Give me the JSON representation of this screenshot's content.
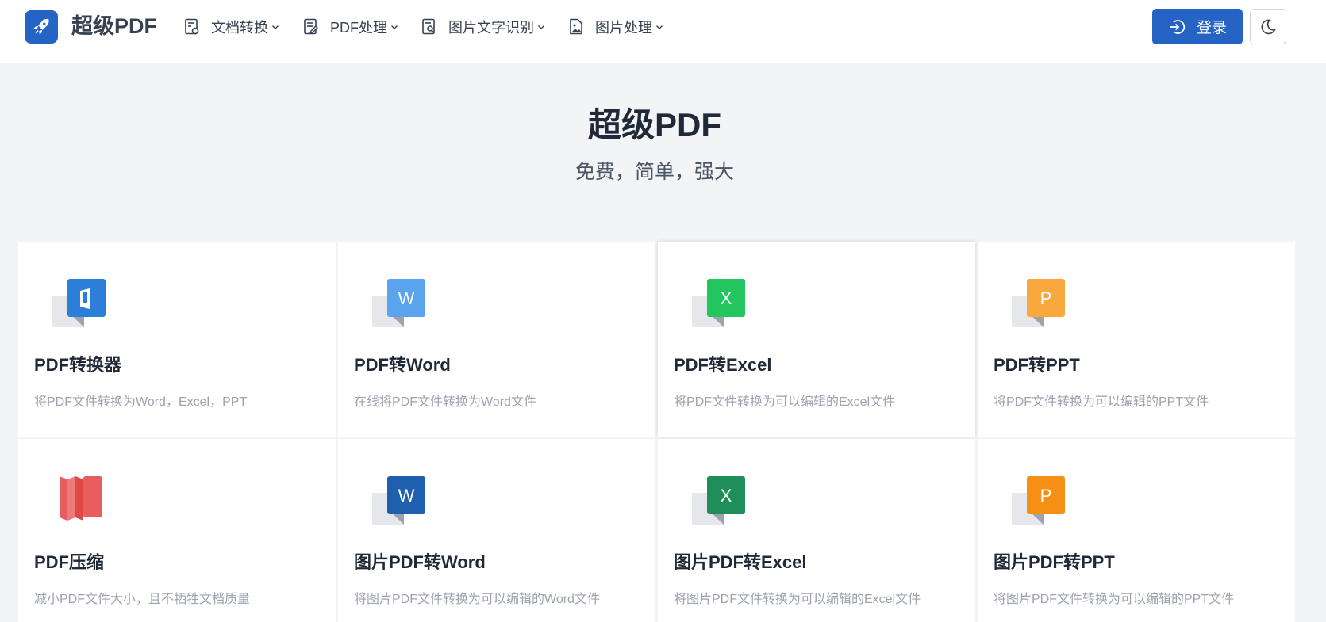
{
  "brand": {
    "name": "超级PDF"
  },
  "nav": {
    "items": [
      {
        "label": "文档转换"
      },
      {
        "label": "PDF处理"
      },
      {
        "label": "图片文字识别"
      },
      {
        "label": "图片处理"
      }
    ],
    "login_label": "登录"
  },
  "hero": {
    "title": "超级PDF",
    "subtitle": "免费，简单，强大"
  },
  "colors": {
    "primary": "#2563c4",
    "converter": "#2b7fd9",
    "word_light": "#5aa4ee",
    "excel_light": "#22c55e",
    "ppt_light": "#f8a83c",
    "compress": "#e85d5d",
    "word_dark": "#1e5fae",
    "excel_dark": "#1f8f5a",
    "ppt_dark": "#f59015"
  },
  "cards": [
    {
      "title": "PDF转换器",
      "desc": "将PDF文件转换为Word，Excel，PPT",
      "icon": "office-icon",
      "letter": ""
    },
    {
      "title": "PDF转Word",
      "desc": "在线将PDF文件转换为Word文件",
      "icon": "word-icon",
      "letter": "W"
    },
    {
      "title": "PDF转Excel",
      "desc": "将PDF文件转换为可以编辑的Excel文件",
      "icon": "excel-icon",
      "letter": "X"
    },
    {
      "title": "PDF转PPT",
      "desc": "将PDF文件转换为可以编辑的PPT文件",
      "icon": "ppt-icon",
      "letter": "P"
    },
    {
      "title": "PDF压缩",
      "desc": "减小PDF文件大小，且不牺牲文档质量",
      "icon": "compress-icon",
      "letter": ""
    },
    {
      "title": "图片PDF转Word",
      "desc": "将图片PDF文件转换为可以编辑的Word文件",
      "icon": "word-icon",
      "letter": "W"
    },
    {
      "title": "图片PDF转Excel",
      "desc": "将图片PDF文件转换为可以编辑的Excel文件",
      "icon": "excel-icon",
      "letter": "X"
    },
    {
      "title": "图片PDF转PPT",
      "desc": "将图片PDF文件转换为可以编辑的PPT文件",
      "icon": "ppt-icon",
      "letter": "P"
    }
  ]
}
